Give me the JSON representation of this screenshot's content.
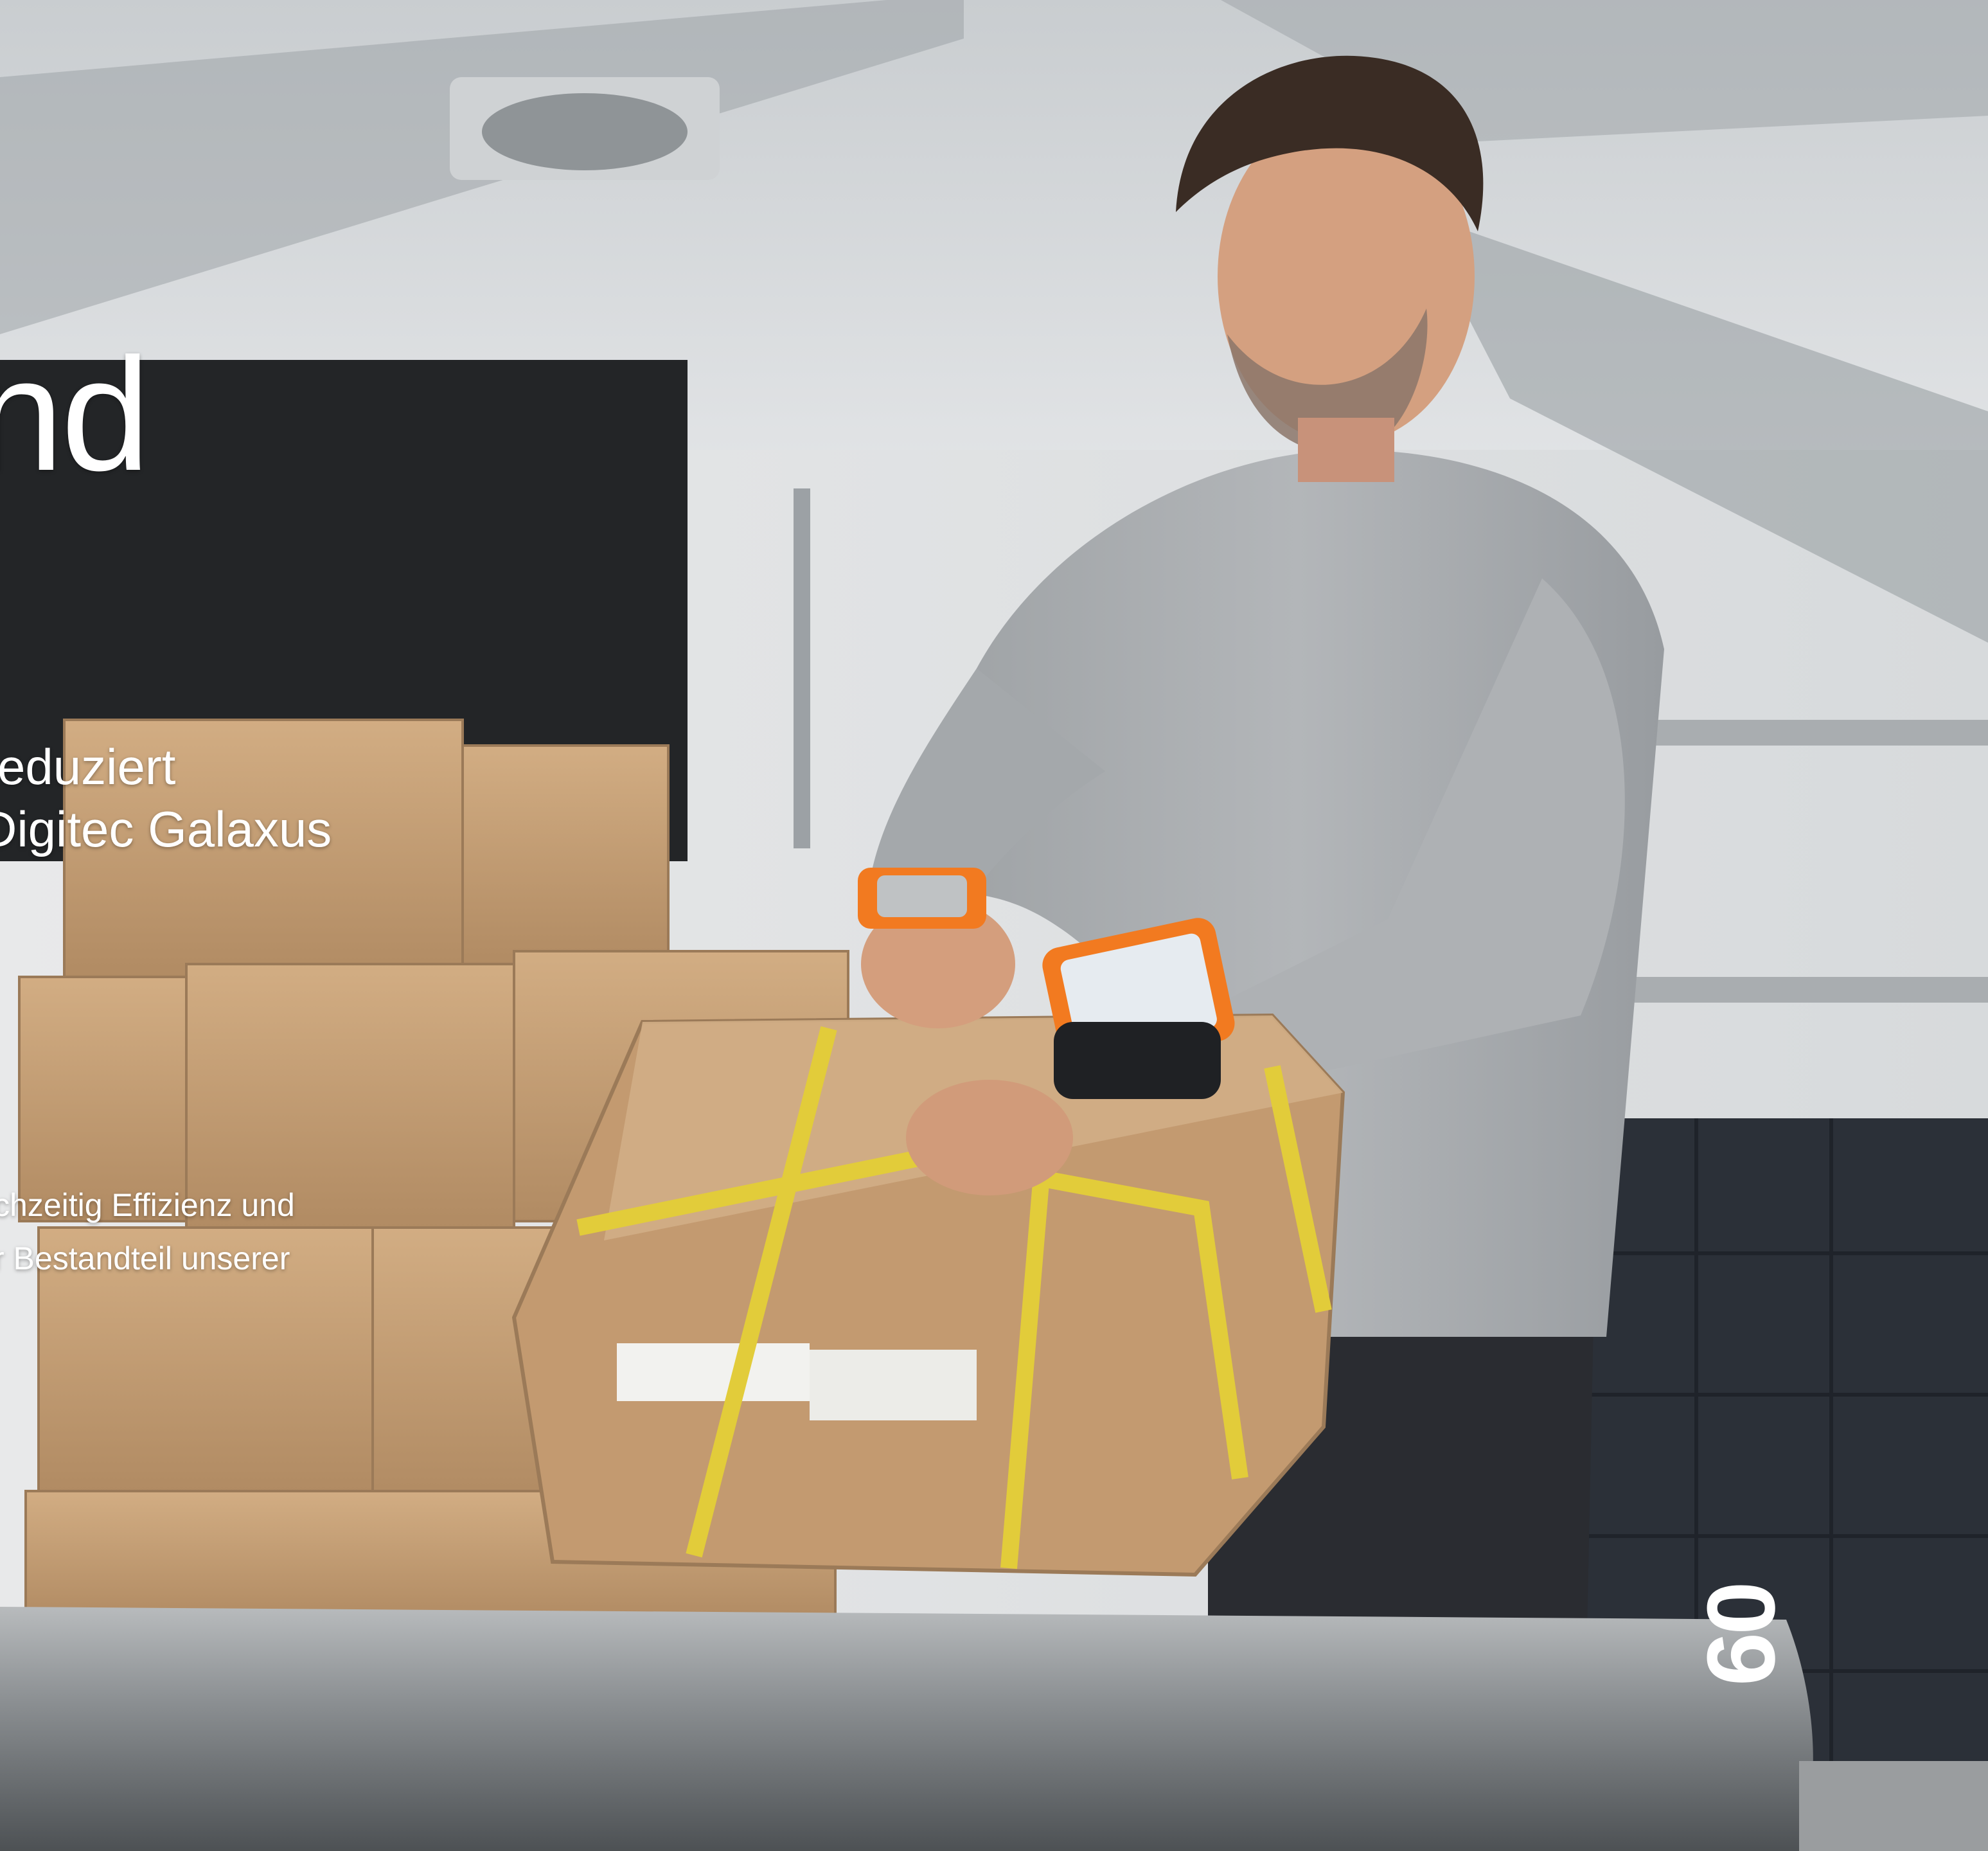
{
  "overlay": {
    "headline": "nd",
    "subhead_line1": "reduziert",
    "subhead_line2": "Digitec Galaxus",
    "body_line1": "chzeitig Effizienz und",
    "body_line2": "r Bestandteil unserer"
  },
  "page_number": "09",
  "photo": {
    "colors": {
      "ceiling": "#d9dcde",
      "back_wall": "#e6e7e8",
      "dark_panel": "#222426",
      "cardboard": "#c9a37a",
      "cardboard_shadow": "#a98561",
      "strap": "#e2cc3a",
      "sweater": "#a9adb0",
      "trousers": "#2a2c31",
      "skin": "#d4a080",
      "hair": "#3a2c24",
      "device_orange": "#f27a20",
      "bins": "#2b3038",
      "foreground_bar": "#8f9396"
    }
  }
}
